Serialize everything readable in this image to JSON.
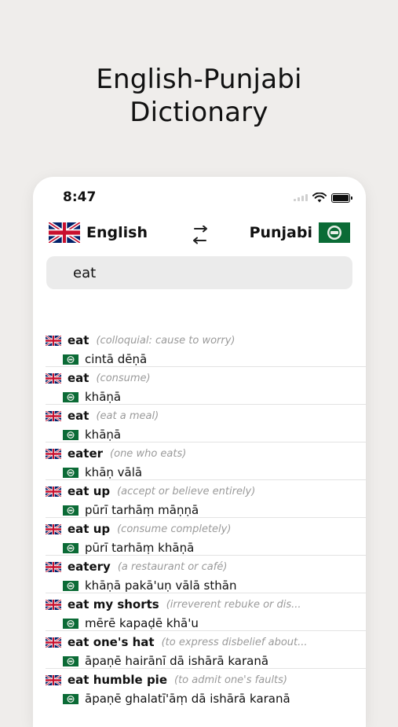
{
  "headline": {
    "line1": "English-Punjabi",
    "line2": "Dictionary"
  },
  "status_bar": {
    "time": "8:47"
  },
  "language_bar": {
    "source": {
      "label": "English",
      "flag": "uk-flag-icon"
    },
    "target": {
      "label": "Punjabi",
      "flag": "pakistan-flag-icon"
    },
    "swap_icon": "swap-arrows-icon"
  },
  "search": {
    "value": "eat"
  },
  "results": [
    {
      "word": "eat",
      "gloss": "(colloquial: cause to worry)",
      "translation": "cintā dēṇā"
    },
    {
      "word": "eat",
      "gloss": "(consume)",
      "translation": "khāṇā"
    },
    {
      "word": "eat",
      "gloss": "(eat a meal)",
      "translation": "khāṇā"
    },
    {
      "word": "eater",
      "gloss": "(one who eats)",
      "translation": "khāṇ vālā"
    },
    {
      "word": "eat up",
      "gloss": "(accept or believe entirely)",
      "translation": "pūrī tarhāṃ māṇṇā"
    },
    {
      "word": "eat up",
      "gloss": "(consume completely)",
      "translation": "pūrī tarhāṃ khāṇā"
    },
    {
      "word": "eatery",
      "gloss": "(a restaurant or café)",
      "translation": "khāṇā pakā'uṇ vālā sthān"
    },
    {
      "word": "eat my shorts",
      "gloss": "(irreverent rebuke or dis...",
      "translation": "mērē kapaḍē khā'u"
    },
    {
      "word": "eat one's hat",
      "gloss": "(to express disbelief about...",
      "translation": "āpaṇē hairānī dā ishārā karanā"
    },
    {
      "word": "eat humble pie",
      "gloss": "(to admit one's faults)",
      "translation": "āpaṇē ghalatī'āṃ dā ishārā karanā"
    }
  ]
}
